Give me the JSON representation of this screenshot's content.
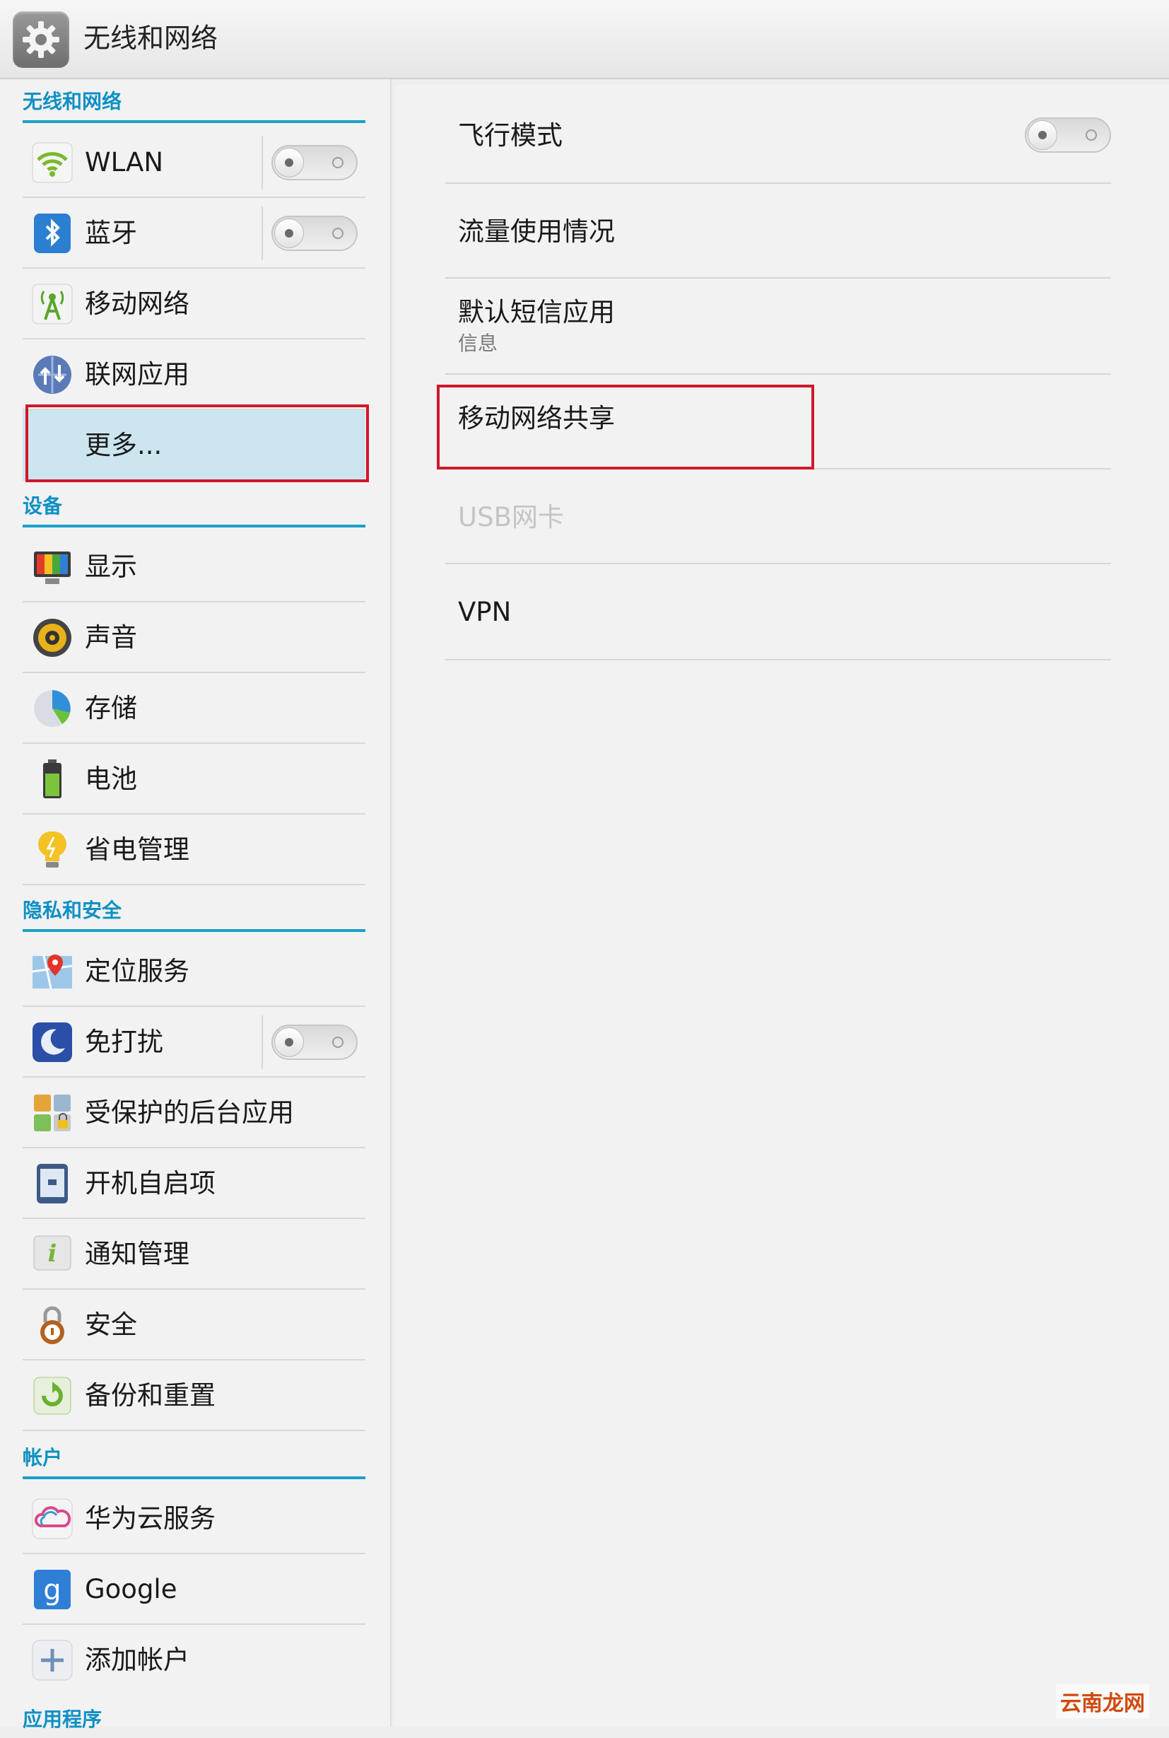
{
  "header": {
    "title": "无线和网络",
    "icon": "gear-icon"
  },
  "sidebar": {
    "sections": {
      "wireless": "无线和网络",
      "device": "设备",
      "privacy": "隐私和安全",
      "accounts": "帐户",
      "apps": "应用程序"
    },
    "items": {
      "wlan": {
        "label": "WLAN",
        "icon": "wifi-icon",
        "toggle": "off"
      },
      "bluetooth": {
        "label": "蓝牙",
        "icon": "bluetooth-icon",
        "toggle": "off"
      },
      "mobile": {
        "label": "移动网络",
        "icon": "mobile-network-icon"
      },
      "netapps": {
        "label": "联网应用",
        "icon": "network-apps-icon"
      },
      "more": {
        "label": "更多...",
        "selected": true
      },
      "display": {
        "label": "显示",
        "icon": "display-icon"
      },
      "sound": {
        "label": "声音",
        "icon": "speaker-icon"
      },
      "storage": {
        "label": "存储",
        "icon": "storage-pie-icon"
      },
      "battery": {
        "label": "电池",
        "icon": "battery-icon"
      },
      "power": {
        "label": "省电管理",
        "icon": "lightbulb-icon"
      },
      "location": {
        "label": "定位服务",
        "icon": "location-icon"
      },
      "dnd": {
        "label": "免打扰",
        "icon": "moon-icon",
        "toggle": "off"
      },
      "protected": {
        "label": "受保护的后台应用",
        "icon": "protected-apps-icon"
      },
      "startup": {
        "label": "开机自启项",
        "icon": "startup-icon"
      },
      "notify": {
        "label": "通知管理",
        "icon": "info-icon"
      },
      "security": {
        "label": "安全",
        "icon": "lock-icon"
      },
      "backup": {
        "label": "备份和重置",
        "icon": "backup-icon"
      },
      "cloud": {
        "label": "华为云服务",
        "icon": "cloud-icon"
      },
      "google": {
        "label": "Google",
        "icon": "google-icon"
      },
      "addaccount": {
        "label": "添加帐户",
        "icon": "plus-icon"
      }
    }
  },
  "main": {
    "airplane": {
      "label": "飞行模式",
      "toggle": "off"
    },
    "data_usage": {
      "label": "流量使用情况"
    },
    "sms": {
      "label": "默认短信应用",
      "sub": "信息"
    },
    "tethering": {
      "label": "移动网络共享"
    },
    "usb": {
      "label": "USB网卡",
      "disabled": true
    },
    "vpn": {
      "label": "VPN"
    }
  },
  "watermark": "云南龙网",
  "colors": {
    "accent": "#19a0c8",
    "highlight": "#d0182a",
    "selected_bg": "#cce6f0"
  }
}
